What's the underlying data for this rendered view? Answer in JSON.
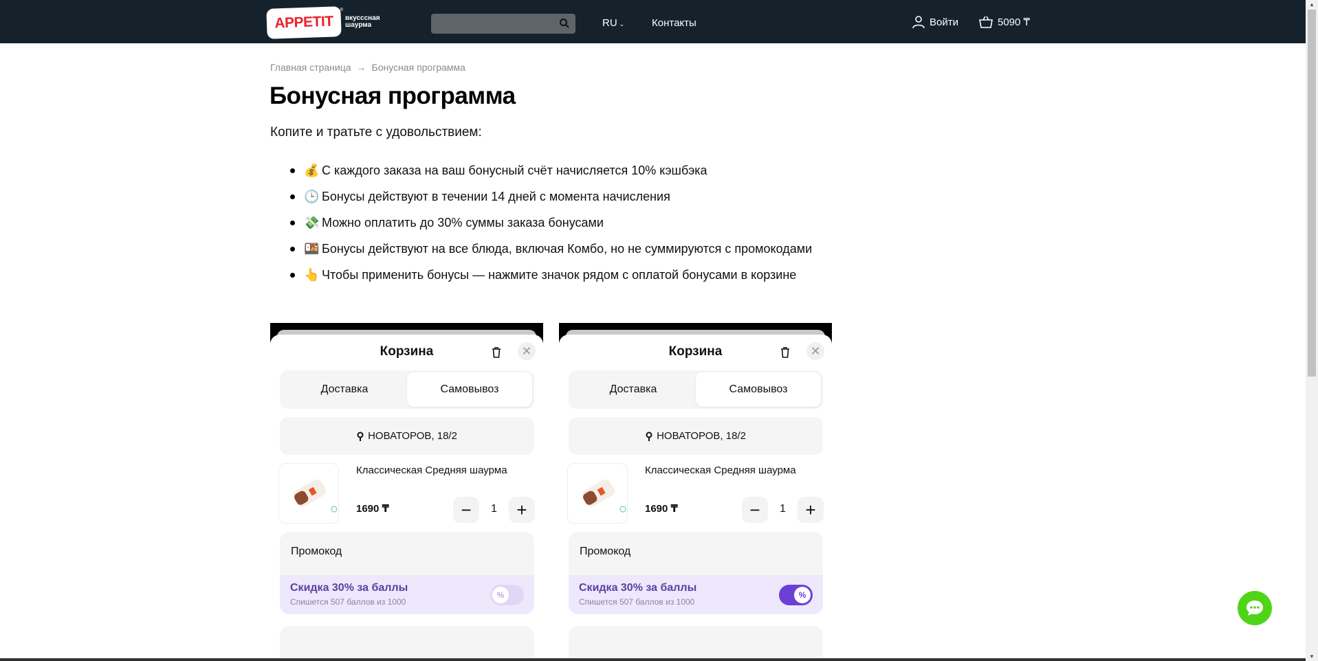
{
  "header": {
    "logo_text": "APPETIT",
    "logo_reg": "®",
    "logo_subtitle": "вкусссная шаурма",
    "search_placeholder": "",
    "lang": "RU",
    "contacts": "Контакты",
    "login": "Войти",
    "cart_total": "5090 ₸"
  },
  "breadcrumb": {
    "home": "Главная страница",
    "current": "Бонусная программа"
  },
  "page": {
    "title": "Бонусная программа",
    "intro": "Копите и тратьте с удовольствием:",
    "bullets": [
      {
        "emoji": "💰",
        "text": "С каждого заказа на ваш бонусный счёт начисляется 10% кэшбэка"
      },
      {
        "emoji": "🕒",
        "text": "Бонусы действуют в течении 14 дней с момента начисления"
      },
      {
        "emoji": "💸",
        "text": "Можно оплатить до 30% суммы заказа бонусами"
      },
      {
        "emoji": "🍱",
        "text": "Бонусы действуют на  все блюда, включая Комбо, но не суммируются с промокодами"
      },
      {
        "emoji": "👆",
        "text": "Чтобы применить бонусы — нажмите значок рядом с оплатой бонусами в корзине"
      }
    ]
  },
  "cart_examples": [
    {
      "title": "Корзина",
      "tab_delivery": "Доставка",
      "tab_pickup": "Самовывоз",
      "address": "НОВАТОРОВ, 18/2",
      "item_name": "Классическая Средняя шаурма",
      "item_price": "1690 ₸",
      "qty": "1",
      "promo_label": "Промокод",
      "bonus_title": "Скидка 30% за баллы",
      "bonus_sub": "Спишется 507 баллов из 1000",
      "toggle_on": false
    },
    {
      "title": "Корзина",
      "tab_delivery": "Доставка",
      "tab_pickup": "Самовывоз",
      "address": "НОВАТОРОВ, 18/2",
      "item_name": "Классическая Средняя шаурма",
      "item_price": "1690 ₸",
      "qty": "1",
      "promo_label": "Промокод",
      "bonus_title": "Скидка 30% за баллы",
      "bonus_sub": "Спишется 507 баллов из 1000",
      "toggle_on": true
    }
  ],
  "colors": {
    "header_bg": "#15222c",
    "brand_red": "#e8232d",
    "bonus_purple": "#6c3fd6",
    "chat_green": "#4fd418"
  }
}
